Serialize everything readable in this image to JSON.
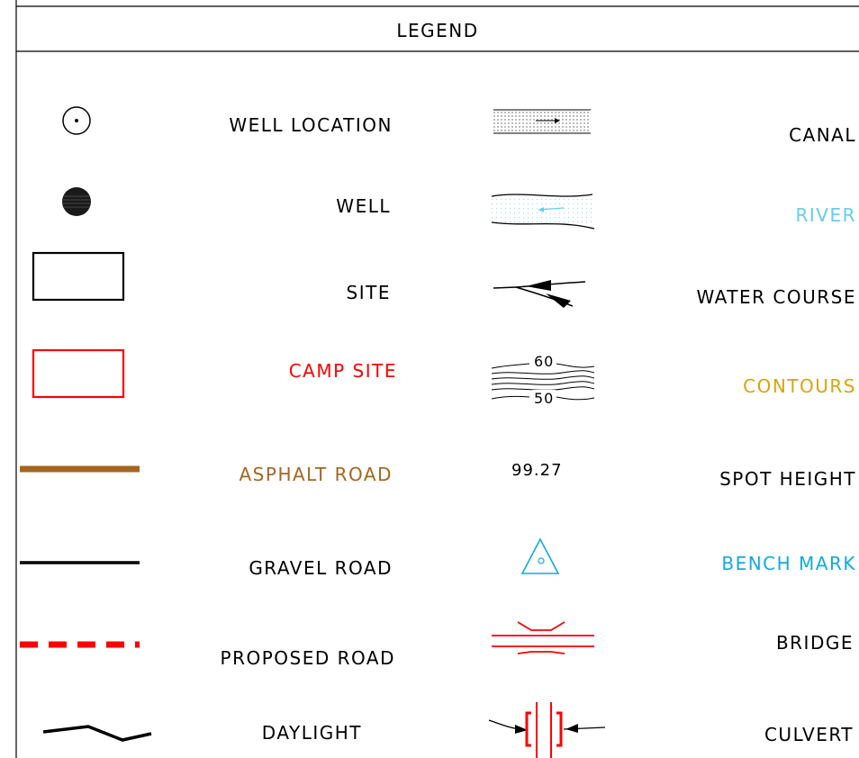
{
  "title": "LEGEND",
  "colors": {
    "black": "#000000",
    "red": "#ff0000",
    "brown": "#a5651e",
    "lightblue": "#66ccee",
    "cyan": "#11aadd",
    "gold": "#d8a410"
  },
  "left_items": [
    {
      "label": "WELL LOCATION",
      "color": "#000000",
      "symbol": "well-location-icon"
    },
    {
      "label": "WELL",
      "color": "#000000",
      "symbol": "well-icon"
    },
    {
      "label": "SITE",
      "color": "#000000",
      "symbol": "site-icon"
    },
    {
      "label": "CAMP SITE",
      "color": "#ff0000",
      "symbol": "camp-site-icon"
    },
    {
      "label": "ASPHALT ROAD",
      "color": "#a5651e",
      "symbol": "asphalt-road-icon"
    },
    {
      "label": "GRAVEL ROAD",
      "color": "#000000",
      "symbol": "gravel-road-icon"
    },
    {
      "label": "PROPOSED ROAD",
      "color": "#000000",
      "symbol": "proposed-road-icon"
    },
    {
      "label": "DAYLIGHT",
      "color": "#000000",
      "symbol": "daylight-icon"
    }
  ],
  "right_items": [
    {
      "label": "CANAL",
      "color": "#000000",
      "symbol": "canal-icon"
    },
    {
      "label": "RIVER",
      "color": "#66ccee",
      "symbol": "river-icon"
    },
    {
      "label": "WATER COURSE",
      "color": "#000000",
      "symbol": "water-course-icon"
    },
    {
      "label": "CONTOURS",
      "color": "#d8a410",
      "symbol": "contours-icon"
    },
    {
      "label": "SPOT HEIGHT",
      "color": "#000000",
      "symbol": "spot-height-icon"
    },
    {
      "label": "BENCH MARK",
      "color": "#11aadd",
      "symbol": "bench-mark-icon"
    },
    {
      "label": "BRIDGE",
      "color": "#000000",
      "symbol": "bridge-icon"
    },
    {
      "label": "CULVERT",
      "color": "#000000",
      "symbol": "culvert-icon"
    }
  ],
  "symbol_text": {
    "contour_upper": "60",
    "contour_lower": "50",
    "spot_height_value": "99.27"
  }
}
